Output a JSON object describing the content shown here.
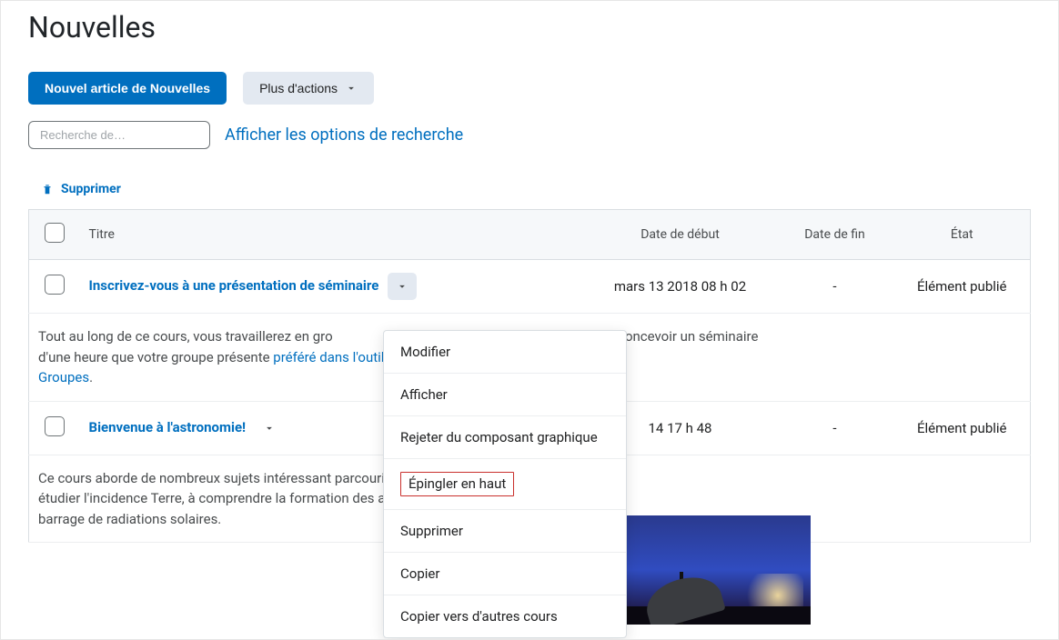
{
  "page": {
    "title": "Nouvelles"
  },
  "actions": {
    "new_article": "Nouvel article de Nouvelles",
    "more_actions": "Plus d'actions"
  },
  "search": {
    "placeholder": "Recherche de…",
    "options_link": "Afficher les options de recherche"
  },
  "toolbar": {
    "delete_label": "Supprimer"
  },
  "table": {
    "headers": {
      "title": "Titre",
      "start": "Date de début",
      "end": "Date de fin",
      "state": "État"
    },
    "rows": [
      {
        "title": "Inscrivez-vous à une présentation de séminaire",
        "start": "mars 13 2018 08 h 02",
        "end": "-",
        "state": "Élément publié",
        "desc_pre": "Tout au long de ce cours, vous travaillerez en gro",
        "desc_mid": "es et concevoir un séminaire d'une heure que votre groupe présente",
        "desc_link1": " préféré dans l'outil",
        "desc_link2": "Groupes",
        "desc_post": "."
      },
      {
        "title": "Bienvenue à l'astronomie!",
        "start": "14 17 h 48",
        "end": "-",
        "state": "Élément publié",
        "desc": "Ce cours aborde de nombreux sujets intéressant parcourir le système solaire, à étudier l'incidence Terre, à comprendre la formation des aurores et planète d'un barrage de radiations solaires."
      }
    ]
  },
  "dropdown": {
    "items": [
      "Modifier",
      "Afficher",
      "Rejeter du composant graphique",
      "Épingler en haut",
      "Supprimer",
      "Copier",
      "Copier vers d'autres cours"
    ],
    "highlight_index": 3
  }
}
